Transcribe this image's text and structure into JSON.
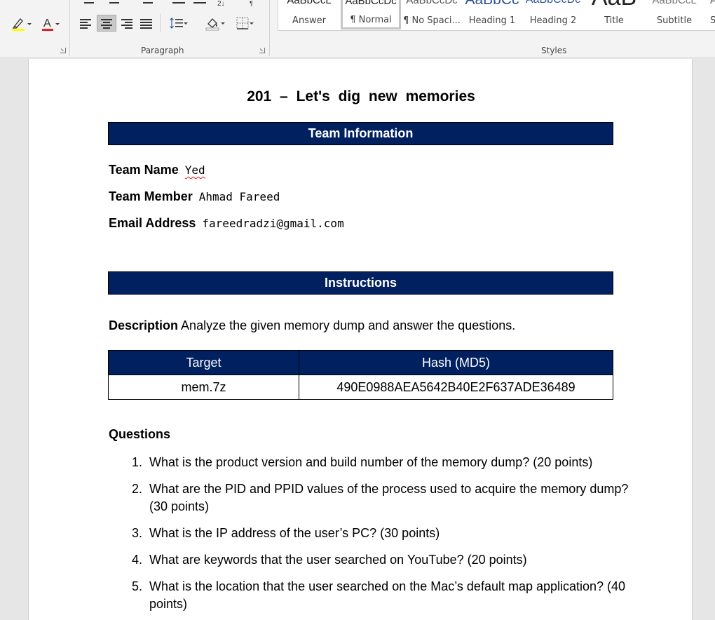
{
  "ribbon": {
    "paragraph_label": "Paragraph",
    "styles_label": "Styles",
    "styles": [
      {
        "sample": "AaBbCcL",
        "name": "Answer"
      },
      {
        "sample": "AaBbCcDc",
        "name": "¶ Normal"
      },
      {
        "sample": "AaBbCcDc",
        "name": "¶ No Spaci..."
      },
      {
        "sample": "AaBbCc",
        "name": "Heading 1"
      },
      {
        "sample": "AaBbCcDc",
        "name": "Heading 2"
      },
      {
        "sample": "AaB",
        "name": "Title"
      },
      {
        "sample": "AaBbCcL",
        "name": "Subtitle"
      },
      {
        "sample": "A",
        "name": "S"
      }
    ],
    "colors": {
      "highlight": "#ffff00",
      "font_color": "#e02020",
      "accent": "#002060"
    },
    "icons": [
      "highlighter-icon",
      "font-color-icon",
      "align-left-icon",
      "align-center-icon",
      "align-right-icon",
      "justify-icon",
      "line-spacing-icon",
      "shading-icon",
      "borders-icon"
    ]
  },
  "document": {
    "title": "201 – Let's dig new memories",
    "team_info_header": "Team Information",
    "fields": [
      {
        "label": "Team Name",
        "value": "Yed"
      },
      {
        "label": "Team Member",
        "value": "Ahmad Fareed"
      },
      {
        "label": "Email Address",
        "value": "fareedradzi@gmail.com"
      }
    ],
    "instructions_header": "Instructions",
    "description_label": "Description",
    "description_text": "Analyze the given memory dump and answer the questions.",
    "table": {
      "headers": [
        "Target",
        "Hash (MD5)"
      ],
      "rows": [
        [
          "mem.7z",
          "490E0988AEA5642B40E2F637ADE36489"
        ]
      ]
    },
    "questions_heading": "Questions",
    "questions": [
      {
        "num": "1.",
        "text": "What is the product version and build number of the memory dump? (20 points)"
      },
      {
        "num": "2.",
        "text": "What are the PID and PPID values of the process used to acquire the memory dump? (30 points)"
      },
      {
        "num": "3.",
        "text": "What is the IP address of the user’s PC? (30 points)"
      },
      {
        "num": "4.",
        "text": "What are keywords that the user searched on YouTube? (20 points)"
      },
      {
        "num": "5.",
        "text": "What is the location that the user searched on the Mac’s default map application? (40 points)"
      }
    ]
  }
}
